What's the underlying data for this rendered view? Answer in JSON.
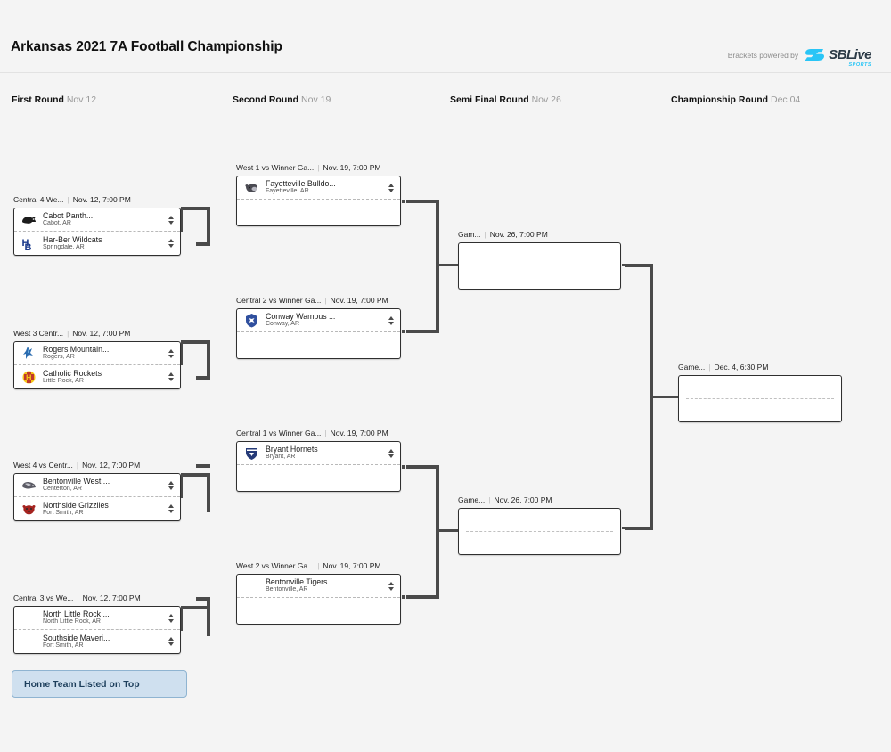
{
  "header": {
    "title": "Arkansas 2021 7A Football Championship",
    "powered_by_text": "Brackets powered by",
    "logo_word": "SBLive",
    "logo_sub": "SPORTS"
  },
  "rounds": [
    {
      "name": "First Round",
      "date": "Nov 12"
    },
    {
      "name": "Second Round",
      "date": "Nov 19"
    },
    {
      "name": "Semi Final Round",
      "date": "Nov 26"
    },
    {
      "name": "Championship Round",
      "date": "Dec 04"
    }
  ],
  "separator": "|",
  "first_round": [
    {
      "label": "Central 4 We...",
      "datetime": "Nov. 12, 7:00 PM",
      "teams": [
        {
          "name": "Cabot Panth...",
          "city": "Cabot, AR",
          "logo": "panther-logo",
          "logo_colors": [
            "#1c1c1c",
            "#7a7a7a"
          ]
        },
        {
          "name": "Har-Ber Wildcats",
          "city": "Springdale, AR",
          "logo": "har-ber-hb-logo",
          "logo_colors": [
            "#1b3a8c",
            "#ffffff"
          ]
        }
      ]
    },
    {
      "label": "West 3 Centr...",
      "datetime": "Nov. 12, 7:00 PM",
      "teams": [
        {
          "name": "Rogers Mountain...",
          "city": "Rogers, AR",
          "logo": "mountaineer-logo",
          "logo_colors": [
            "#2b6cb0",
            "#86c5f0"
          ]
        },
        {
          "name": "Catholic Rockets",
          "city": "Little Rock, AR",
          "logo": "rockets-logo",
          "logo_colors": [
            "#c0392b",
            "#f5c518"
          ]
        }
      ]
    },
    {
      "label": "West 4 vs Centr...",
      "datetime": "Nov. 12, 7:00 PM",
      "teams": [
        {
          "name": "Bentonville West ...",
          "city": "Centerton, AR",
          "logo": "wolverine-logo",
          "logo_colors": [
            "#5c5c66",
            "#c8c8cf"
          ]
        },
        {
          "name": "Northside Grizzlies",
          "city": "Fort Smith, AR",
          "logo": "grizzly-logo",
          "logo_colors": [
            "#a5231f",
            "#2b2b2b"
          ]
        }
      ]
    },
    {
      "label": "Central 3 vs We...",
      "datetime": "Nov. 12, 7:00 PM",
      "teams": [
        {
          "name": "North Little Rock ...",
          "city": "North Little Rock, AR",
          "logo": "",
          "logo_colors": []
        },
        {
          "name": "Southside Maveri...",
          "city": "Fort Smith, AR",
          "logo": "",
          "logo_colors": []
        }
      ]
    }
  ],
  "second_round": [
    {
      "label": "West 1 vs Winner Ga...",
      "datetime": "Nov. 19, 7:00 PM",
      "teams": [
        {
          "name": "Fayetteville Bulldo...",
          "city": "Fayetteville, AR",
          "logo": "bulldog-logo",
          "logo_colors": [
            "#4a4a52",
            "#b9b9c2"
          ]
        }
      ]
    },
    {
      "label": "Central 2 vs Winner Ga...",
      "datetime": "Nov. 19, 7:00 PM",
      "teams": [
        {
          "name": "Conway Wampus ...",
          "city": "Conway, AR",
          "logo": "wampus-cat-logo",
          "logo_colors": [
            "#2f4f9e",
            "#ffffff"
          ]
        }
      ]
    },
    {
      "label": "Central 1 vs Winner Ga...",
      "datetime": "Nov. 19, 7:00 PM",
      "teams": [
        {
          "name": "Bryant Hornets",
          "city": "Bryant, AR",
          "logo": "hornet-shield-logo",
          "logo_colors": [
            "#253a78",
            "#ffffff"
          ]
        }
      ]
    },
    {
      "label": "West 2 vs Winner Ga...",
      "datetime": "Nov. 19, 7:00 PM",
      "teams": [
        {
          "name": "Bentonville Tigers",
          "city": "Bentonville, AR",
          "logo": "",
          "logo_colors": []
        }
      ]
    }
  ],
  "semi_final_round": [
    {
      "label": "Gam...",
      "datetime": "Nov. 26, 7:00 PM",
      "teams": []
    },
    {
      "label": "Game...",
      "datetime": "Nov. 26, 7:00 PM",
      "teams": []
    }
  ],
  "championship_round": [
    {
      "label": "Game...",
      "datetime": "Dec. 4, 6:30 PM",
      "teams": []
    }
  ],
  "legend": {
    "text": "Home Team Listed on Top"
  }
}
